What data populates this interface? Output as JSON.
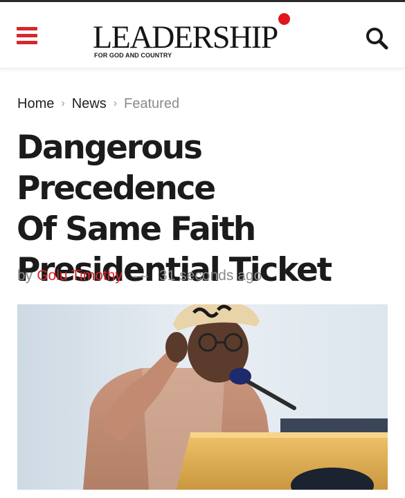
{
  "header": {
    "logo_text": "LEADERSHIP",
    "logo_tagline": "FOR GOD AND COUNTRY",
    "menu_icon": "hamburger-menu-icon",
    "search_icon": "search-icon"
  },
  "breadcrumb": {
    "items": [
      "Home",
      "News",
      "Featured"
    ],
    "separator_icon": "chevron-right-icon"
  },
  "article": {
    "title_lines": [
      "Dangerous Precedence",
      "Of Same Faith",
      "Presidential Ticket"
    ],
    "by_label": "by",
    "author": "Golu Timothy",
    "dash": "—",
    "timestamp": "31 seconds ago"
  },
  "colors": {
    "brand_red": "#d8262b",
    "text_dark": "#1b1b1b",
    "text_muted": "#8a8a8a"
  }
}
